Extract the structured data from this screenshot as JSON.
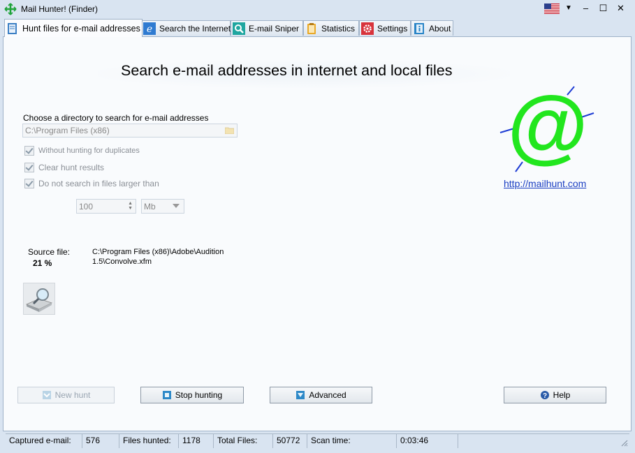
{
  "window": {
    "title": "Mail Hunter! (Finder)",
    "minimize": "–",
    "maximize": "☐",
    "close": "✕"
  },
  "tabs": [
    {
      "label": "Hunt files for e-mail addresses",
      "icon": "document-icon"
    },
    {
      "label": "Search the Internet",
      "icon": "internet-explorer-icon"
    },
    {
      "label": "E-mail Sniper",
      "icon": "magnifier-icon"
    },
    {
      "label": "Statistics",
      "icon": "clipboard-icon"
    },
    {
      "label": "Settings",
      "icon": "gear-icon"
    },
    {
      "label": "About",
      "icon": "info-book-icon"
    }
  ],
  "main": {
    "heading": "Search e-mail addresses in internet and local files",
    "dir_label": "Choose a directory to search for e-mail addresses",
    "dir_value": "C:\\Program Files (x86)",
    "options": [
      {
        "label": "Without hunting for duplicates",
        "checked": true
      },
      {
        "label": "Clear hunt results",
        "checked": true
      },
      {
        "label": "Do not search in files larger than",
        "checked": true
      }
    ],
    "size_value": "100",
    "size_unit": "Mb",
    "source_label": "Source file:",
    "progress": "21 %",
    "source_path": "C:\\Program Files (x86)\\Adobe\\Audition 1.5\\Convolve.xfm",
    "link": "http://mailhunt.com"
  },
  "buttons": {
    "new_hunt": "New hunt",
    "stop": "Stop hunting",
    "advanced": "Advanced",
    "help": "Help"
  },
  "status": {
    "captured_label": "Captured e-mail:",
    "captured_value": "576",
    "files_label": "Files hunted:",
    "files_value": "1178",
    "total_label": "Total Files:",
    "total_value": "50772",
    "time_label": "Scan time:",
    "time_value": "0:03:46"
  },
  "colors": {
    "accent_green": "#22e61e",
    "link_blue": "#1a3ec2"
  }
}
